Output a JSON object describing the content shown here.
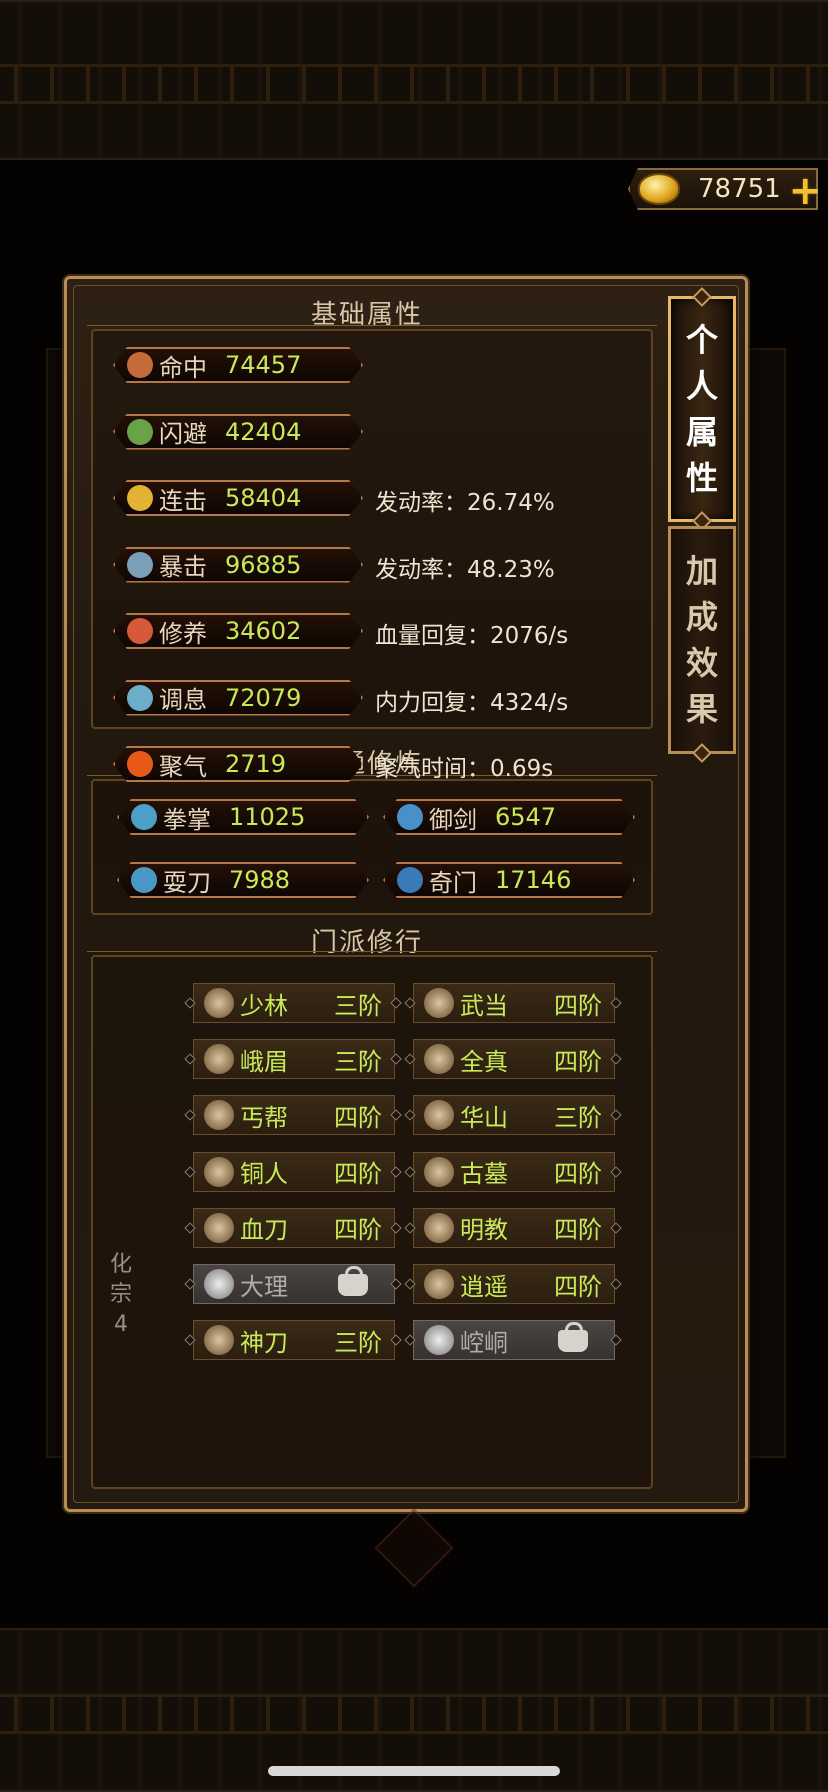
{
  "currency": {
    "value": "78751",
    "icon": "gold-ingot-icon",
    "add": "+"
  },
  "tabs": [
    {
      "label": "个\n人\n属\n性"
    },
    {
      "label": "加\n成\n效\n果"
    }
  ],
  "basic": {
    "title": "基础属性",
    "stats": [
      {
        "icon": "accuracy-icon",
        "label": "命中",
        "value": "74457",
        "extra": ""
      },
      {
        "icon": "dodge-icon",
        "label": "闪避",
        "value": "42404",
        "extra": ""
      },
      {
        "icon": "combo-icon",
        "label": "连击",
        "value": "58404",
        "extra": "发动率：26.74%"
      },
      {
        "icon": "crit-icon",
        "label": "暴击",
        "value": "96885",
        "extra": "发动率：48.23%"
      },
      {
        "icon": "heart-icon",
        "label": "修养",
        "value": "34602",
        "extra": "血量回复：2076/s"
      },
      {
        "icon": "breath-icon",
        "label": "调息",
        "value": "72079",
        "extra": "内力回复：4324/s"
      },
      {
        "icon": "flame-icon",
        "label": "聚气",
        "value": "2719",
        "extra": "聚气时间：0.69s"
      }
    ]
  },
  "mastery": {
    "title": "精通修炼",
    "items": [
      {
        "icon": "fist-icon",
        "label": "拳掌",
        "value": "11025"
      },
      {
        "icon": "sword-icon",
        "label": "御剑",
        "value": "6547"
      },
      {
        "icon": "blade-icon",
        "label": "耍刀",
        "value": "7988"
      },
      {
        "icon": "exotic-icon",
        "label": "奇门",
        "value": "17146"
      }
    ]
  },
  "sects": {
    "title": "门派修行",
    "side_label": "化\n宗\n4",
    "left": [
      {
        "icon": "shaolin-icon",
        "name": "少林",
        "rank": "三阶",
        "locked": false
      },
      {
        "icon": "emei-icon",
        "name": "峨眉",
        "rank": "三阶",
        "locked": false
      },
      {
        "icon": "beggar-icon",
        "name": "丐帮",
        "rank": "四阶",
        "locked": false
      },
      {
        "icon": "bronze-man-icon",
        "name": "铜人",
        "rank": "四阶",
        "locked": false
      },
      {
        "icon": "blood-blade-icon",
        "name": "血刀",
        "rank": "四阶",
        "locked": false
      },
      {
        "icon": "dali-icon",
        "name": "大理",
        "rank": "",
        "locked": true
      },
      {
        "icon": "divine-blade-icon",
        "name": "神刀",
        "rank": "三阶",
        "locked": false
      }
    ],
    "right": [
      {
        "icon": "wudang-icon",
        "name": "武当",
        "rank": "四阶",
        "locked": false
      },
      {
        "icon": "quanzhen-icon",
        "name": "全真",
        "rank": "四阶",
        "locked": false
      },
      {
        "icon": "huashan-icon",
        "name": "华山",
        "rank": "三阶",
        "locked": false
      },
      {
        "icon": "ancient-tomb-icon",
        "name": "古墓",
        "rank": "四阶",
        "locked": false
      },
      {
        "icon": "mingjiao-icon",
        "name": "明教",
        "rank": "四阶",
        "locked": false
      },
      {
        "icon": "xiaoyao-icon",
        "name": "逍遥",
        "rank": "四阶",
        "locked": false
      },
      {
        "icon": "kongtong-icon",
        "name": "崆峒",
        "rank": "",
        "locked": true
      }
    ]
  }
}
